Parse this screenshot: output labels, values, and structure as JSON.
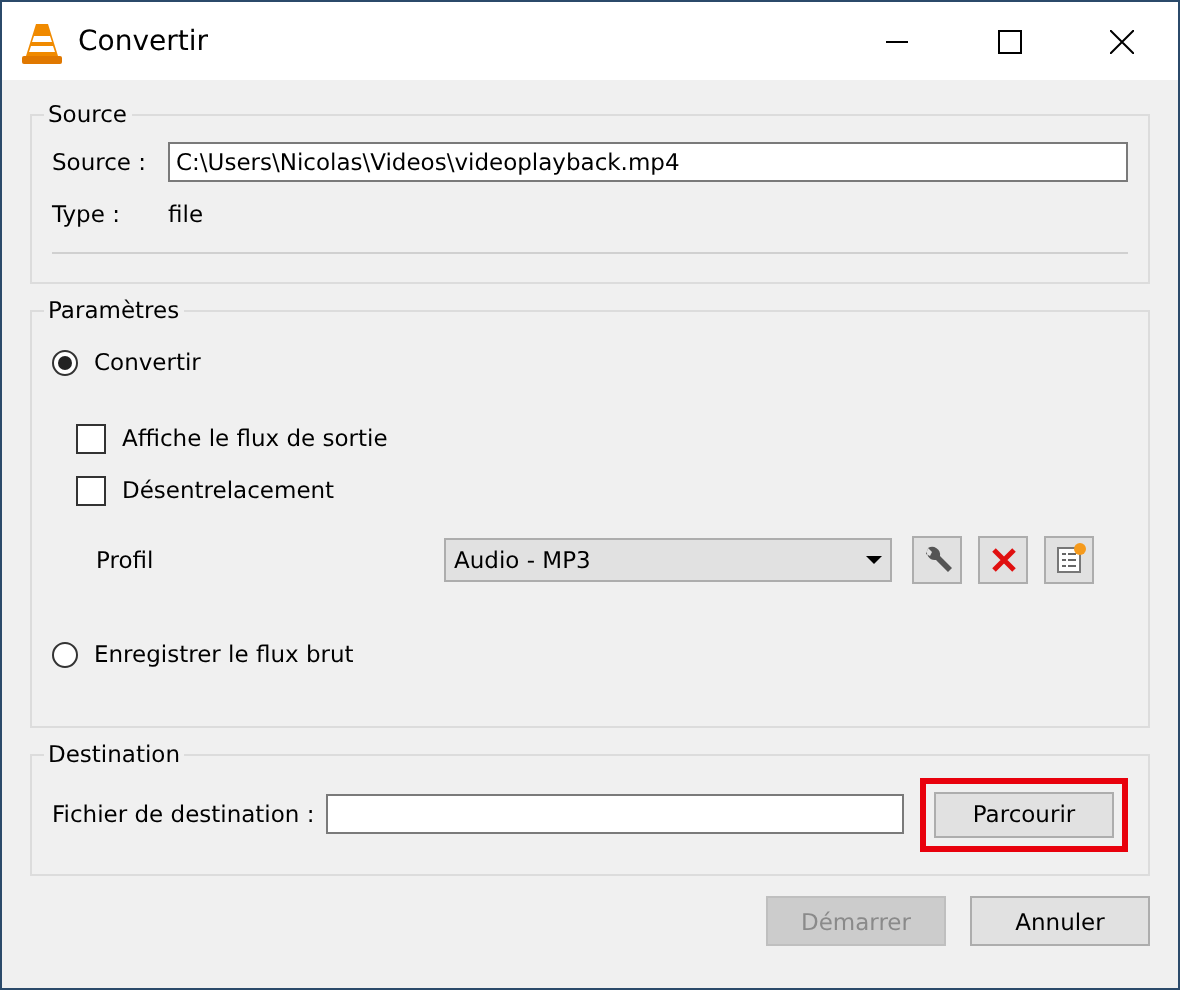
{
  "window": {
    "title": "Convertir"
  },
  "source": {
    "title": "Source",
    "source_label": "Source :",
    "source_value": "C:\\Users\\Nicolas\\Videos\\videoplayback.mp4",
    "type_label": "Type :",
    "type_value": "file"
  },
  "parameters": {
    "title": "Paramètres",
    "modes": [
      {
        "label": "Convertir",
        "selected": true
      },
      {
        "label": "Enregistrer le flux brut",
        "selected": false
      }
    ],
    "options": [
      {
        "label": "Affiche le flux de sortie",
        "checked": false
      },
      {
        "label": "Désentrelacement",
        "checked": false
      }
    ],
    "profile_label": "Profil",
    "profile_value": "Audio - MP3"
  },
  "destination": {
    "title": "Destination",
    "file_label": "Fichier de destination :",
    "browse_button": "Parcourir",
    "browse_highlighted": true
  },
  "buttons": [
    {
      "label": "Démarrer",
      "disabled": true
    },
    {
      "label": "Annuler",
      "disabled": false
    }
  ]
}
